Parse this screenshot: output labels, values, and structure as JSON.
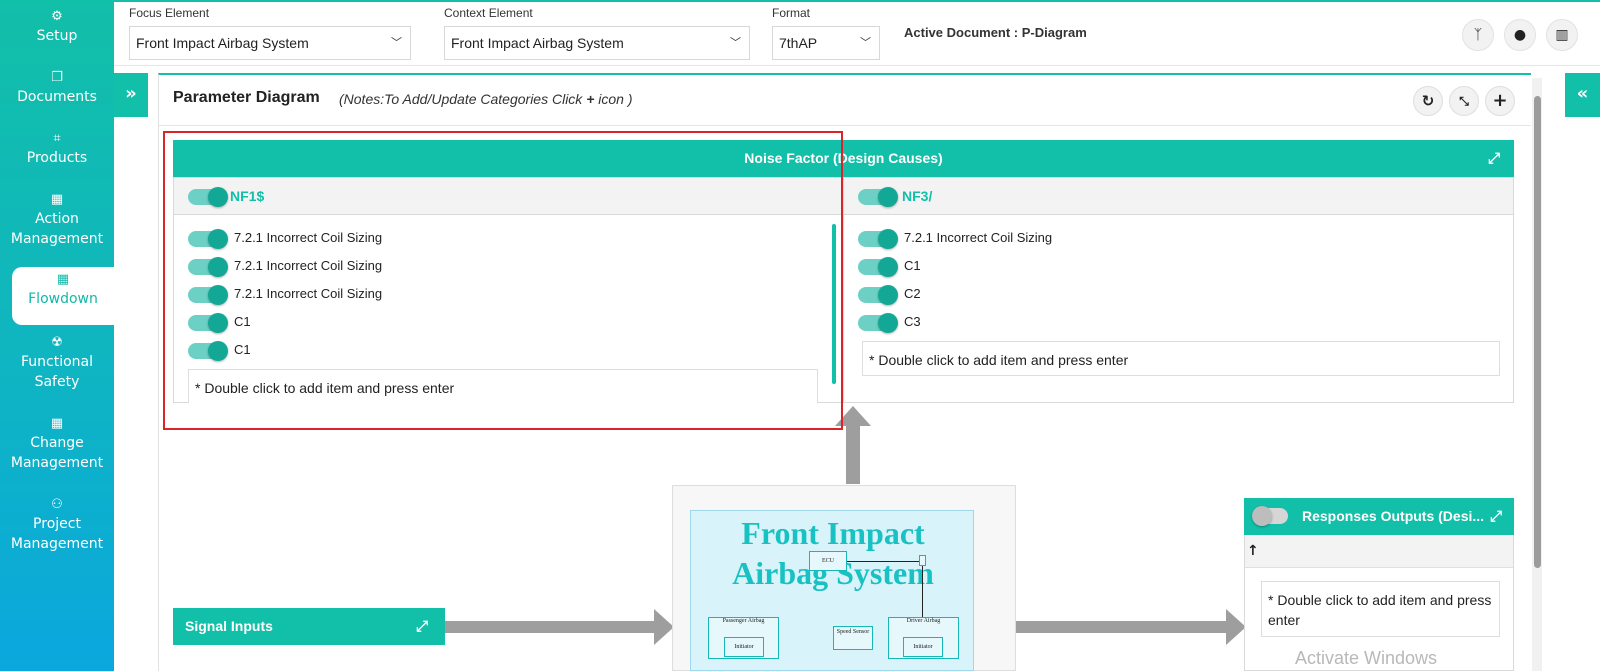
{
  "sidebar": {
    "items": [
      {
        "label": "Setup",
        "icon": "gears-icon"
      },
      {
        "label": "Documents",
        "icon": "copy-icon"
      },
      {
        "label": "Products",
        "icon": "product-icon"
      },
      {
        "label": "Action Management",
        "icon": "building-icon"
      },
      {
        "label": "Flowdown",
        "icon": "building-icon",
        "active": true
      },
      {
        "label": "Functional Safety",
        "icon": "radiation-icon"
      },
      {
        "label": "Change Management",
        "icon": "building-icon"
      },
      {
        "label": "Project Management",
        "icon": "sitemap-icon"
      }
    ]
  },
  "topbar": {
    "focus_label": "Focus Element",
    "focus_value": "Front Impact Airbag System",
    "context_label": "Context Element",
    "context_value": "Front Impact Airbag System",
    "format_label": "Format",
    "format_value": "7thAP",
    "active_document": "Active Document : P-Diagram",
    "buttons": [
      "route-icon",
      "droplet-icon",
      "chart-icon"
    ]
  },
  "panel": {
    "title": "Parameter Diagram",
    "note_prefix": "(Notes:To Add/Update Categories Click ",
    "note_plus": "+",
    "note_suffix": " icon )",
    "buttons": [
      "refresh-icon",
      "compress-icon",
      "plus-icon"
    ]
  },
  "noise": {
    "header": "Noise Factor (Design Causes)",
    "groups": [
      {
        "title": "NF1$",
        "items": [
          "7.2.1 Incorrect Coil Sizing",
          "7.2.1 Incorrect Coil Sizing",
          "7.2.1 Incorrect Coil Sizing",
          "C1",
          "C1"
        ],
        "add_placeholder": "* Double click to add item and press enter"
      },
      {
        "title": "NF3/",
        "items": [
          "7.2.1 Incorrect Coil Sizing",
          "C1",
          "C2",
          "C3"
        ],
        "add_placeholder": "* Double click to add item and press enter"
      }
    ]
  },
  "signal_inputs": {
    "label": "Signal Inputs"
  },
  "diagram": {
    "title": "Front Impact Airbag System",
    "nodes": {
      "ecu": "ECU",
      "passenger": "Passenger Airbag",
      "initiator1": "Initiator",
      "speed": "Speed Sensor",
      "driver": "Driver Airbag",
      "initiator2": "Initiator"
    }
  },
  "responses": {
    "header": "Responses Outputs (Desi...",
    "sort_glyph": "↑",
    "add_placeholder": "* Double click to add item and press enter"
  },
  "watermark": "Activate Windows",
  "colors": {
    "accent": "#12bfa8",
    "selection": "#d9242a"
  }
}
